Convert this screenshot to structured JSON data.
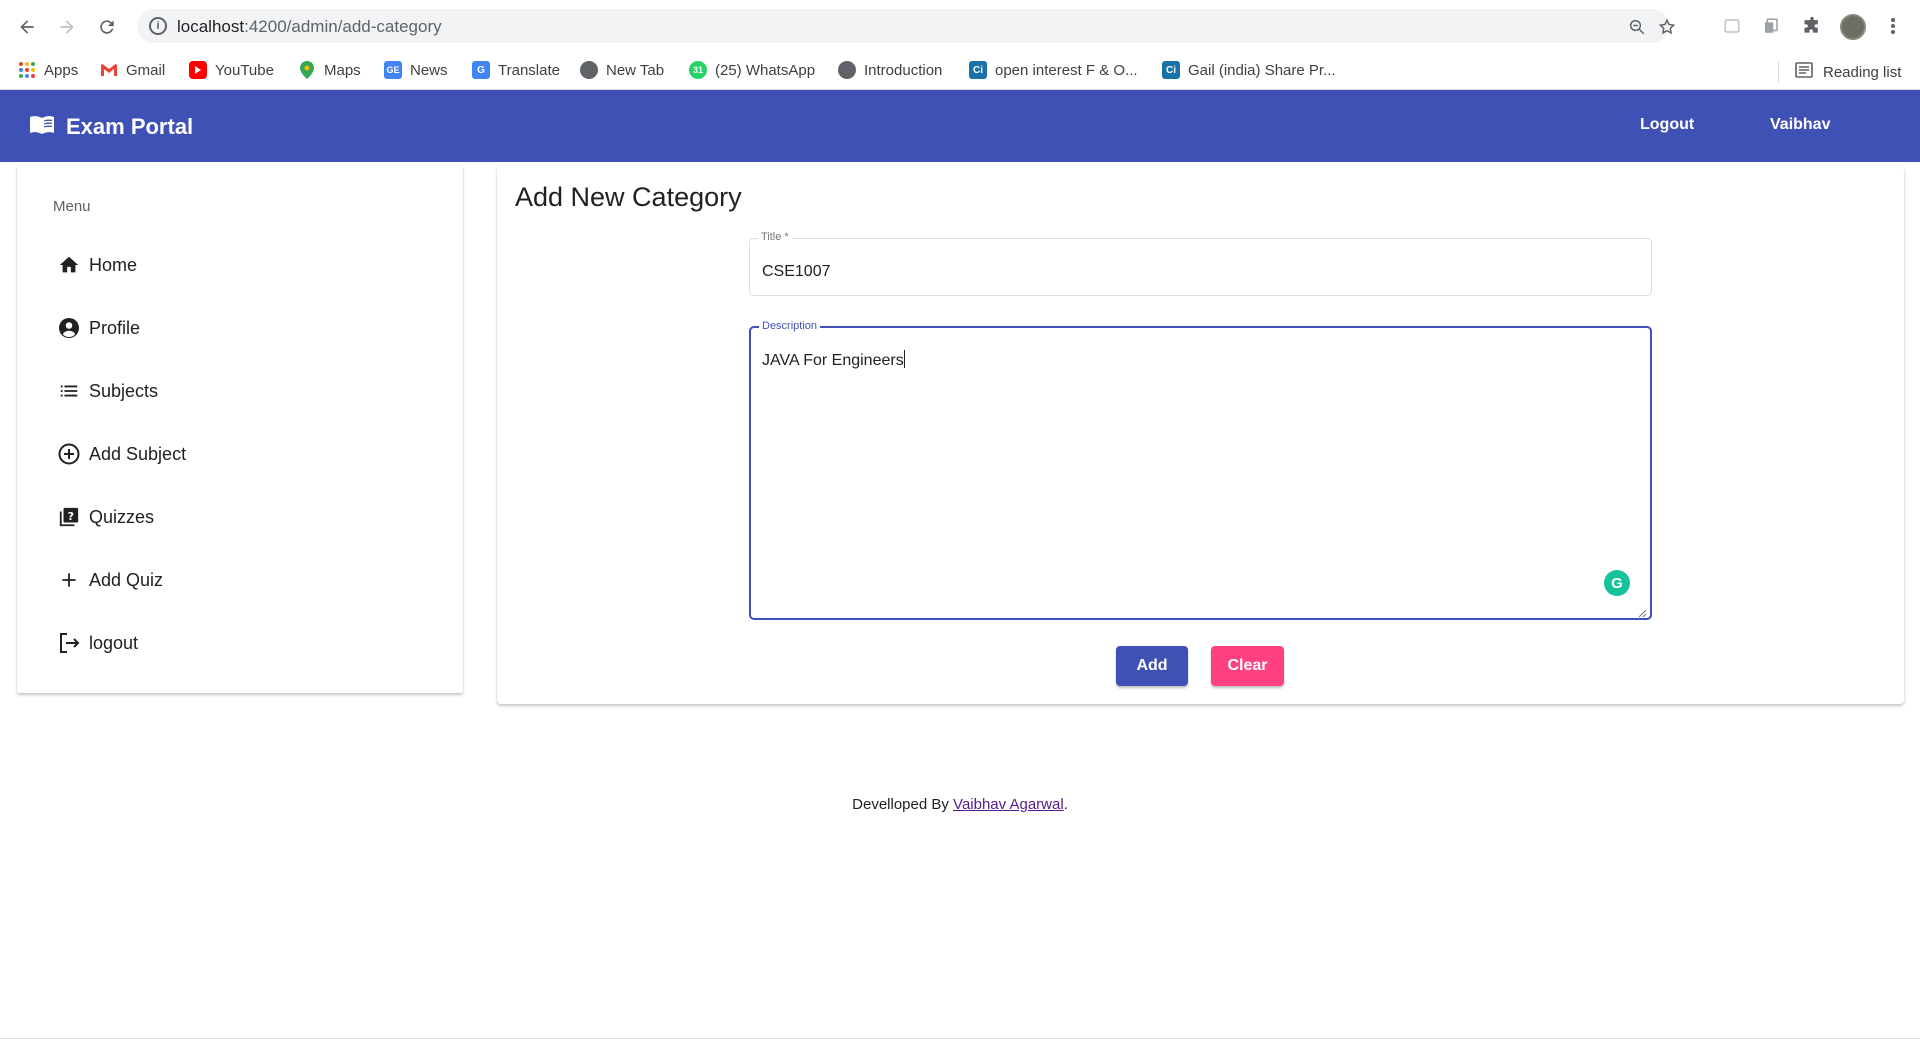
{
  "browser": {
    "url_host": "localhost",
    "url_path": ":4200/admin/add-category",
    "bookmarks": [
      {
        "label": "Apps",
        "icon": "apps-grid-icon"
      },
      {
        "label": "Gmail",
        "icon": "gmail-icon"
      },
      {
        "label": "YouTube",
        "icon": "youtube-icon"
      },
      {
        "label": "Maps",
        "icon": "maps-pin-icon"
      },
      {
        "label": "News",
        "icon": "news-icon"
      },
      {
        "label": "Translate",
        "icon": "translate-icon"
      },
      {
        "label": "New Tab",
        "icon": "globe-icon"
      },
      {
        "label": "(25) WhatsApp",
        "icon": "whatsapp-icon"
      },
      {
        "label": "Introduction",
        "icon": "globe-icon"
      },
      {
        "label": "open interest F & O...",
        "icon": "ci-icon"
      },
      {
        "label": "Gail (india) Share Pr...",
        "icon": "ci-icon"
      }
    ],
    "reading_list": "Reading list"
  },
  "toolbar": {
    "brand": "Exam Portal",
    "logout": "Logout",
    "user": "Vaibhav",
    "color": "#3f51b5"
  },
  "sidebar": {
    "subheader": "Menu",
    "items": [
      {
        "label": "Home",
        "icon": "home-icon"
      },
      {
        "label": "Profile",
        "icon": "account-circle-icon"
      },
      {
        "label": "Subjects",
        "icon": "list-icon"
      },
      {
        "label": "Add Subject",
        "icon": "add-circle-icon"
      },
      {
        "label": "Quizzes",
        "icon": "quiz-icon"
      },
      {
        "label": "Add Quiz",
        "icon": "plus-icon"
      },
      {
        "label": "logout",
        "icon": "logout-icon"
      }
    ]
  },
  "main": {
    "title": "Add New Category",
    "title_field": {
      "label": "Title *",
      "value": "CSE1007"
    },
    "description_field": {
      "label": "Description",
      "value": "JAVA For Engineers"
    },
    "add_button": "Add",
    "clear_button": "Clear",
    "accent_color": "#ff4081"
  },
  "footer": {
    "prefix": "Develloped By ",
    "author": "Vaibhav Agarwal",
    "suffix": "."
  }
}
